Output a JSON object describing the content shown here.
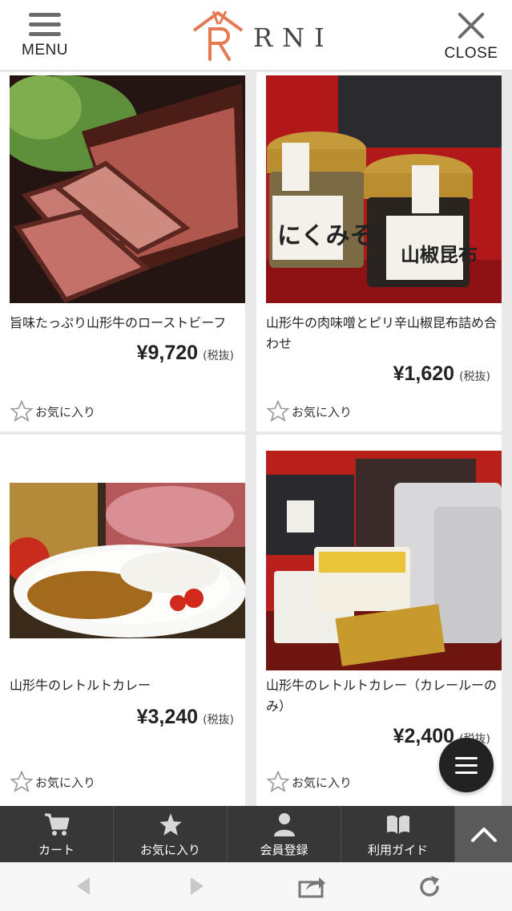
{
  "header": {
    "menu_label": "MENU",
    "logo_text": "RNI",
    "close_label": "CLOSE"
  },
  "products": [
    {
      "name": "旨味たっぷり山形牛のローストビーフ",
      "price": "¥9,720",
      "tax": "(税抜)",
      "favorite_label": "お気に入り"
    },
    {
      "name": "山形牛の肉味噌とピリ辛山椒昆布詰め合わせ",
      "price": "¥1,620",
      "tax": "(税抜)",
      "favorite_label": "お気に入り",
      "jar_label_1": "にくみそ",
      "jar_label_2": "山椒昆布"
    },
    {
      "name": "山形牛のレトルトカレー",
      "price": "¥3,240",
      "tax": "(税抜)",
      "favorite_label": "お気に入り"
    },
    {
      "name": "山形牛のレトルトカレー（カレールーのみ）",
      "price": "¥2,400",
      "tax": "(税抜)",
      "favorite_label": "お気に入り"
    }
  ],
  "tabbar": {
    "items": [
      {
        "label": "カート",
        "icon": "cart-icon"
      },
      {
        "label": "お気に入り",
        "icon": "star-icon"
      },
      {
        "label": "会員登録",
        "icon": "user-icon"
      },
      {
        "label": "利用ガイド",
        "icon": "book-icon"
      }
    ],
    "top_icon": "chevron-up-icon"
  },
  "browser": {
    "icons": [
      "back-icon",
      "forward-icon",
      "share-icon",
      "reload-icon"
    ]
  }
}
